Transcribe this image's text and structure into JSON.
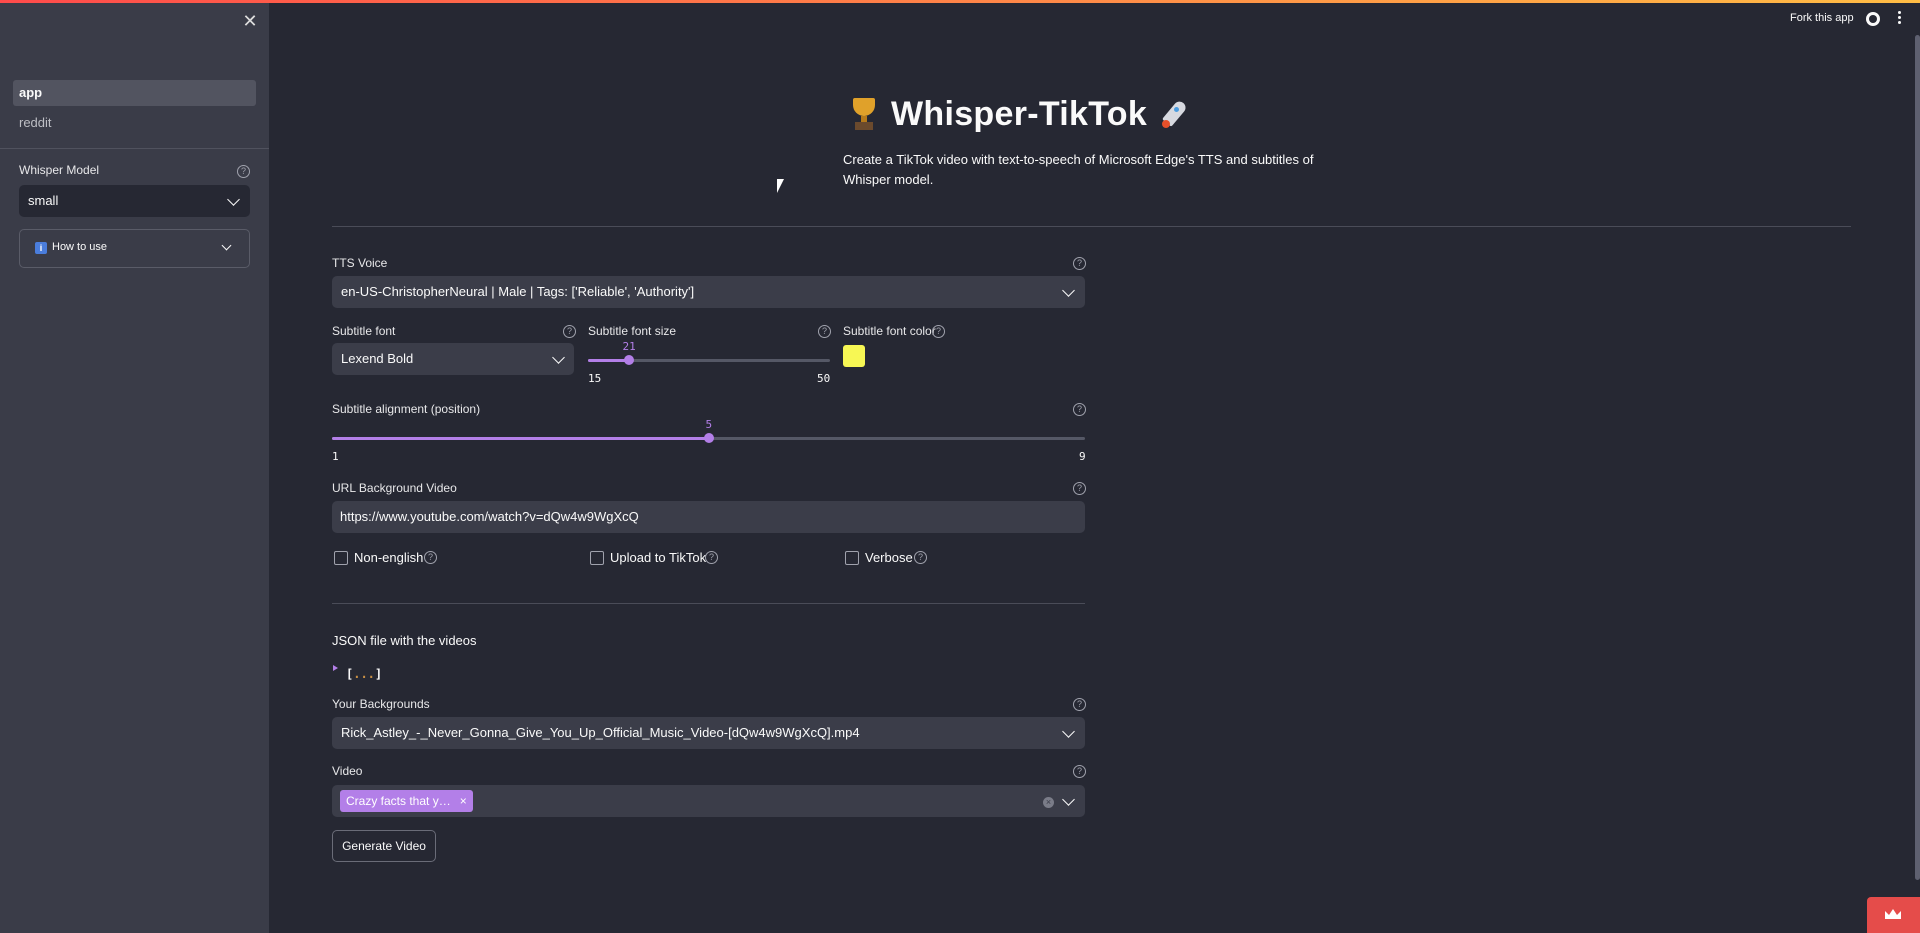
{
  "sidebar": {
    "nav": [
      "app",
      "reddit"
    ],
    "whisper_label": "Whisper Model",
    "whisper_value": "small",
    "how_to_use": "How to use"
  },
  "header": {
    "fork": "Fork this app"
  },
  "main": {
    "title": "Whisper-TikTok",
    "subtitle": "Create a TikTok video with text-to-speech of Microsoft Edge's TTS and subtitles of Whisper model.",
    "tts_label": "TTS Voice",
    "tts_value": "en-US-ChristopherNeural | Male | Tags: ['Reliable', 'Authority']",
    "font_label": "Subtitle font",
    "font_value": "Lexend Bold",
    "size_label": "Subtitle font size",
    "size_value": "21",
    "size_min": "15",
    "size_max": "50",
    "size_fraction": 0.171,
    "color_label": "Subtitle font color",
    "color_value": "#f7f754",
    "align_label": "Subtitle alignment (position)",
    "align_value": "5",
    "align_min": "1",
    "align_max": "9",
    "align_fraction": 0.5,
    "url_label": "URL Background Video",
    "url_value": "https://www.youtube.com/watch?v=dQw4w9WgXcQ",
    "checkbox_nonenglish": "Non-english",
    "checkbox_upload": "Upload to TikTok",
    "checkbox_verbose": "Verbose",
    "json_heading": "JSON file with the videos",
    "json_collapsed": "...",
    "backgrounds_label": "Your Backgrounds",
    "backgrounds_value": "Rick_Astley_-_Never_Gonna_Give_You_Up_Official_Music_Video-[dQw4w9WgXcQ].mp4",
    "video_label": "Video",
    "video_tag": "Crazy facts that y…",
    "generate": "Generate Video"
  }
}
